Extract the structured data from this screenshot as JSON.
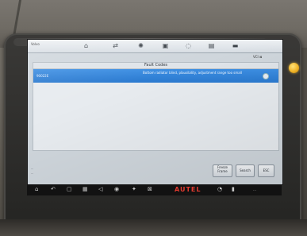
{
  "scene": {
    "description_colors": {
      "background": "#5d5951",
      "tablet_body": "#2f2e2c",
      "screen": "#cfd6dc",
      "highlight_row": "#2f7fd6",
      "power_button": "#f0b428",
      "logo": "#e23a2f"
    }
  },
  "tablet": {
    "brand_logo": "AUTEL",
    "screen": {
      "topbar": {
        "vehicle_label": "Volvo",
        "icons": [
          "home-icon",
          "vehicle-swap-icon",
          "settings-icon",
          "print-icon",
          "help-icon",
          "save-icon",
          "data-logging-icon"
        ],
        "status": "VCI ⊠"
      },
      "panel": {
        "title": "Fault Codes",
        "fault": {
          "code": "90022E",
          "description": "Bottom radiator blind, plausibility, adjustment range too small"
        }
      },
      "footer": {
        "line1": "…",
        "line2": "…"
      },
      "buttons": {
        "freeze_frame": "Freeze Frame",
        "search": "Search",
        "esc": "ESC"
      }
    },
    "android_nav": {
      "clock": "…"
    }
  }
}
